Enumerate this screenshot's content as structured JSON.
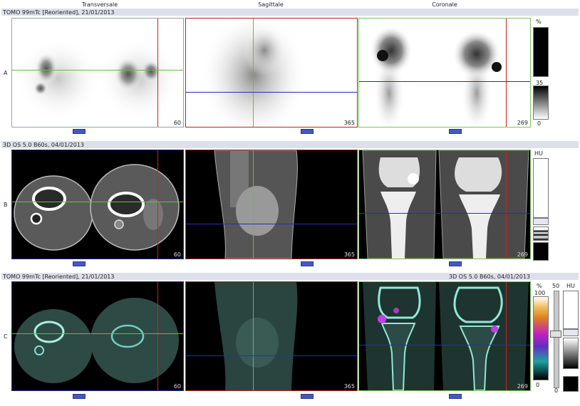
{
  "columns": {
    "transversale": "Transversale",
    "sagittale": "Sagittale",
    "coronale": "Coronale"
  },
  "rows": {
    "a": {
      "letter": "A",
      "header": "TOMO 99mTc [Reoriented], 21/01/2013"
    },
    "b": {
      "letter": "B",
      "header": "3D  OS  5.0  B60s, 04/01/2013"
    },
    "c": {
      "letter": "C",
      "header_left": "TOMO 99mTc [Reoriented], 21/01/2013",
      "header_right": "3D  OS  5.0  B60s, 04/01/2013"
    }
  },
  "slices": {
    "transversale": "60",
    "sagittale": "365",
    "coronale": "269"
  },
  "scales": {
    "a": {
      "unit": "%",
      "mid": "35",
      "min": "0"
    },
    "b": {
      "unit": "HU"
    },
    "c": {
      "unit_left": "%",
      "max_left": "100",
      "min_left": "0",
      "mid": "50",
      "zero": "0",
      "unit_right": "HU"
    }
  },
  "colors": {
    "strip": "#dde0ea",
    "border_blue": "#1a2aa0",
    "border_red": "#c02020",
    "border_green": "#80c060",
    "crosshair_red": "#d02020",
    "crosshair_green": "#60c040",
    "crosshair_blue": "#2030c0"
  }
}
